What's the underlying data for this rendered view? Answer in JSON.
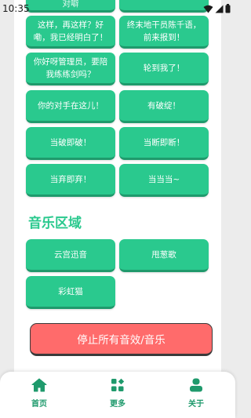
{
  "status_bar": {
    "time": "10:35",
    "icons": [
      "wifi-icon",
      "signal-icon",
      "battery-icon"
    ]
  },
  "top_partial": {
    "left_fragment": "对噼"
  },
  "voice_buttons": [
    {
      "label": "这样，再这样？好嘞，我已经明白了！"
    },
    {
      "label": "终末地干员陈千语，前来报到！"
    },
    {
      "label": "你好呀管理员，要陪我练练剑吗？"
    },
    {
      "label": "轮到我了！"
    },
    {
      "label": "你的对手在这儿！"
    },
    {
      "label": "有破绽！"
    },
    {
      "label": "当破即破！"
    },
    {
      "label": "当断即断！"
    },
    {
      "label": "当弃即弃！"
    },
    {
      "label": "当当当~"
    }
  ],
  "music_section": {
    "title": "音乐区域",
    "buttons": [
      {
        "label": "云宫迅音"
      },
      {
        "label": "甩葱歌"
      },
      {
        "label": "彩虹猫"
      }
    ]
  },
  "stop_button": {
    "label": "停止所有音效/音乐"
  },
  "bottom_nav": {
    "items": [
      {
        "label": "首页",
        "icon": "home-icon"
      },
      {
        "label": "更多",
        "icon": "more-icon"
      },
      {
        "label": "关于",
        "icon": "profile-icon"
      }
    ]
  },
  "colors": {
    "accent": "#2ac98e",
    "accent_dark": "#1f9a6c",
    "stop": "#ff6b6b",
    "background": "#ececec"
  }
}
